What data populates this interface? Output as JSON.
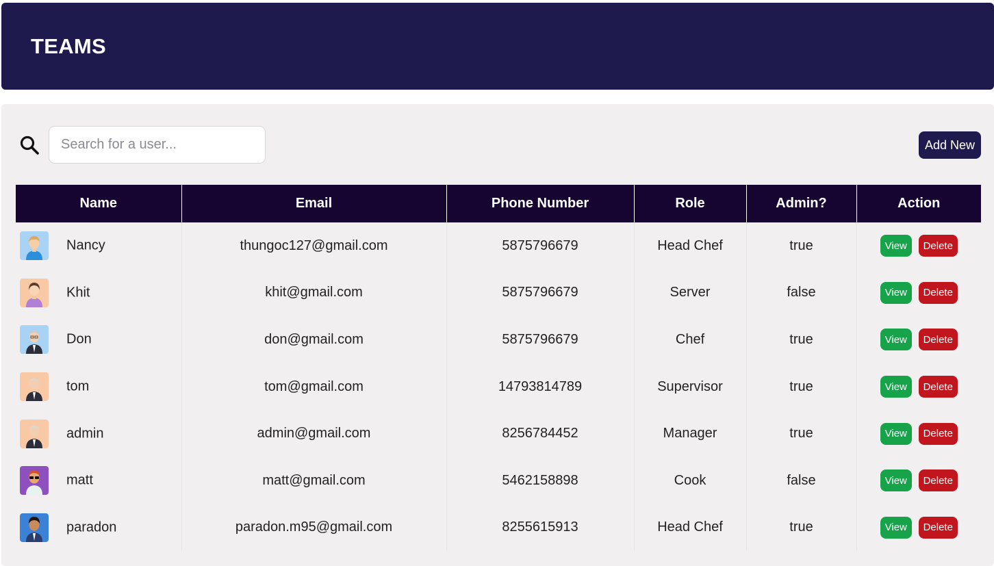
{
  "header": {
    "title": "TEAMS"
  },
  "search": {
    "placeholder": "Search for a user...",
    "value": "",
    "icon": "search-icon"
  },
  "toolbar": {
    "add_label": "Add New"
  },
  "table": {
    "columns": [
      "Name",
      "Email",
      "Phone Number",
      "Role",
      "Admin?",
      "Action"
    ],
    "rows": [
      {
        "name": "Nancy",
        "email": "thungoc127@gmail.com",
        "phone": "5875796679",
        "role": "Head Chef",
        "admin": "true",
        "view": "View",
        "delete": "Delete"
      },
      {
        "name": "Khit",
        "email": "khit@gmail.com",
        "phone": "5875796679",
        "role": "Server",
        "admin": "false",
        "view": "View",
        "delete": "Delete"
      },
      {
        "name": "Don",
        "email": "don@gmail.com",
        "phone": "5875796679",
        "role": "Chef",
        "admin": "true",
        "view": "View",
        "delete": "Delete"
      },
      {
        "name": "tom",
        "email": "tom@gmail.com",
        "phone": "14793814789",
        "role": "Supervisor",
        "admin": "true",
        "view": "View",
        "delete": "Delete"
      },
      {
        "name": "admin",
        "email": "admin@gmail.com",
        "phone": "8256784452",
        "role": "Manager",
        "admin": "true",
        "view": "View",
        "delete": "Delete"
      },
      {
        "name": "matt",
        "email": "matt@gmail.com",
        "phone": "5462158898",
        "role": "Cook",
        "admin": "false",
        "view": "View",
        "delete": "Delete"
      },
      {
        "name": "paradon",
        "email": "paradon.m95@gmail.com",
        "phone": "8255615913",
        "role": "Head Chef",
        "admin": "true",
        "view": "View",
        "delete": "Delete"
      }
    ]
  },
  "colors": {
    "header_bg": "#1f1a4d",
    "table_header_bg": "#160530",
    "panel_bg": "#f1eff0",
    "view_button": "#16a34a",
    "delete_button": "#c1161d"
  }
}
